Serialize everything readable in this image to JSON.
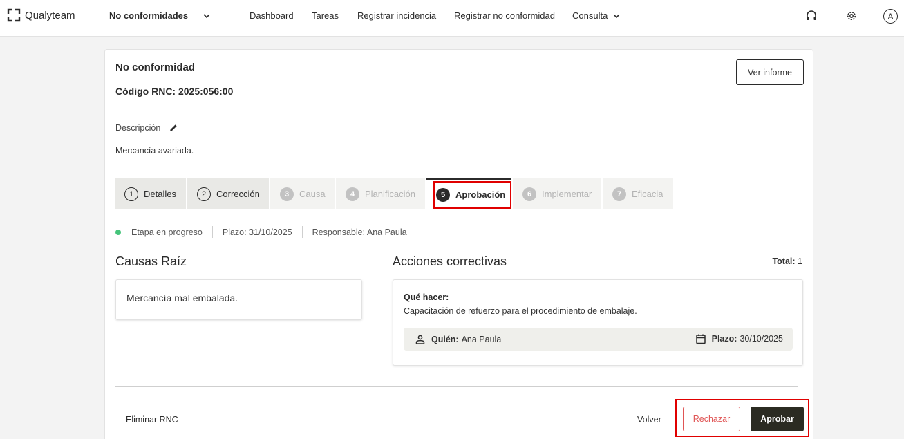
{
  "app": {
    "logo_text": "Qualyteam",
    "module": "No conformidades"
  },
  "nav": [
    "Dashboard",
    "Tareas",
    "Registrar incidencia",
    "Registrar no conformidad",
    "Consulta"
  ],
  "user_initial": "A",
  "header": {
    "title": "No conformidad",
    "code": "Código RNC: 2025:056:00",
    "report_button": "Ver informe"
  },
  "description": {
    "label": "Descripción",
    "text": "Mercancía avariada."
  },
  "steps": [
    {
      "num": "1",
      "label": "Detalles",
      "state": "done"
    },
    {
      "num": "2",
      "label": "Corrección",
      "state": "done"
    },
    {
      "num": "3",
      "label": "Causa",
      "state": "todo"
    },
    {
      "num": "4",
      "label": "Planificación",
      "state": "todo"
    },
    {
      "num": "5",
      "label": "Aprobación",
      "state": "active"
    },
    {
      "num": "6",
      "label": "Implementar",
      "state": "todo"
    },
    {
      "num": "7",
      "label": "Eficacia",
      "state": "todo"
    }
  ],
  "status": {
    "stage": "Etapa en progreso",
    "deadline": "Plazo: 31/10/2025",
    "responsible": "Responsable: Ana Paula",
    "dot_color": "#45c47a"
  },
  "causes": {
    "heading": "Causas Raíz",
    "items": [
      "Mercancía mal embalada."
    ]
  },
  "actions": {
    "heading": "Acciones correctivas",
    "total_label": "Total:",
    "total_value": "1",
    "items": [
      {
        "what_label": "Qué hacer:",
        "what": "Capacitación de refuerzo para el procedimiento de embalaje.",
        "who_label": "Quién:",
        "who": "Ana Paula",
        "deadline_label": "Plazo:",
        "deadline": "30/10/2025"
      }
    ]
  },
  "footer": {
    "delete": "Eliminar RNC",
    "back": "Volver",
    "reject": "Rechazar",
    "approve": "Aprobar"
  }
}
